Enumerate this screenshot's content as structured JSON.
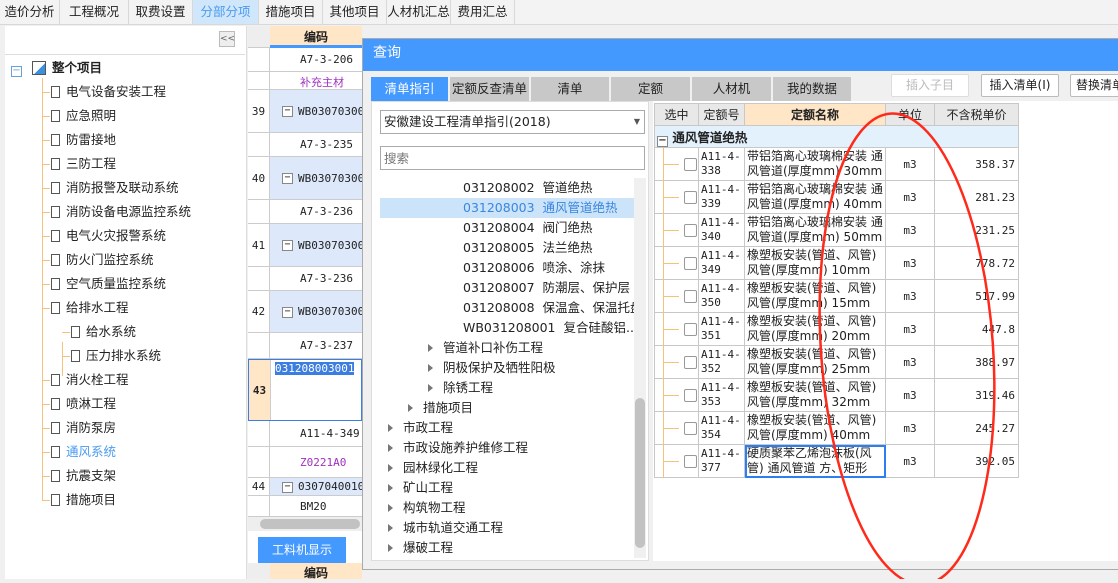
{
  "topnav": [
    "造价分析",
    "工程概况",
    "取费设置",
    "分部分项",
    "措施项目",
    "其他项目",
    "人材机汇总",
    "费用汇总"
  ],
  "left_tree": {
    "root": "整个项目",
    "items": [
      {
        "label": "电气设备安装工程",
        "level": 1
      },
      {
        "label": "应急照明",
        "level": 1
      },
      {
        "label": "防雷接地",
        "level": 1
      },
      {
        "label": "三防工程",
        "level": 1
      },
      {
        "label": "消防报警及联动系统",
        "level": 1
      },
      {
        "label": "消防设备电源监控系统",
        "level": 1
      },
      {
        "label": "电气火灾报警系统",
        "level": 1
      },
      {
        "label": "防火门监控系统",
        "level": 1
      },
      {
        "label": "空气质量监控系统",
        "level": 1
      },
      {
        "label": "给排水工程",
        "level": 1
      },
      {
        "label": "给水系统",
        "level": 2
      },
      {
        "label": "压力排水系统",
        "level": 2
      },
      {
        "label": "消火栓工程",
        "level": 1
      },
      {
        "label": "喷淋工程",
        "level": 1
      },
      {
        "label": "消防泵房",
        "level": 1
      },
      {
        "label": "通风系统",
        "level": 1,
        "active": true
      },
      {
        "label": "抗震支架",
        "level": 1
      },
      {
        "label": "措施项目",
        "level": 1
      }
    ]
  },
  "grid": {
    "header": "编码",
    "rows": [
      {
        "n": "",
        "code": "A7-3-206"
      },
      {
        "n": "",
        "code": "补充主材"
      },
      {
        "n": "39",
        "code": "WB03070300"
      },
      {
        "n": "",
        "code": "A7-3-235"
      },
      {
        "n": "40",
        "code": "WB03070300"
      },
      {
        "n": "",
        "code": "A7-3-236"
      },
      {
        "n": "41",
        "code": "WB03070300"
      },
      {
        "n": "",
        "code": "A7-3-236"
      },
      {
        "n": "42",
        "code": "WB03070300"
      },
      {
        "n": "",
        "code": "A7-3-237"
      },
      {
        "n": "43",
        "code": "031208003001"
      },
      {
        "n": "",
        "code": "A11-4-349"
      },
      {
        "n": "",
        "code": "Z0221A0"
      },
      {
        "n": "44",
        "code": "0307040010"
      },
      {
        "n": "",
        "code": "BM20"
      }
    ],
    "bottom_tab": "工料机显示",
    "bottom_header": "编码"
  },
  "dialog": {
    "title": "查询",
    "tabs": [
      "清单指引",
      "定额反查清单",
      "清单",
      "定额",
      "人材机",
      "我的数据"
    ],
    "buttons": [
      "插入子目",
      "插入清单(I)",
      "替换清单"
    ],
    "select": "安徽建设工程清单指引(2018)",
    "search_placeholder": "搜索",
    "codes": [
      {
        "code": "031208002",
        "name": "管道绝热"
      },
      {
        "code": "031208003",
        "name": "通风管道绝热",
        "selected": true
      },
      {
        "code": "031208004",
        "name": "阀门绝热"
      },
      {
        "code": "031208005",
        "name": "法兰绝热"
      },
      {
        "code": "031208006",
        "name": "喷涂、涂抹"
      },
      {
        "code": "031208007",
        "name": "防潮层、保护层"
      },
      {
        "code": "031208008",
        "name": "保温盒、保温托盘"
      },
      {
        "code": "WB031208001",
        "name": "复合硅酸铝..."
      }
    ],
    "folders": [
      {
        "label": "管道补口补伤工程",
        "level": 3
      },
      {
        "label": "阴极保护及牺牲阳极",
        "level": 3
      },
      {
        "label": "除锈工程",
        "level": 3
      },
      {
        "label": "措施项目",
        "level": 2
      },
      {
        "label": "市政工程",
        "level": 1
      },
      {
        "label": "市政设施养护维修工程",
        "level": 1
      },
      {
        "label": "园林绿化工程",
        "level": 1
      },
      {
        "label": "矿山工程",
        "level": 1
      },
      {
        "label": "构筑物工程",
        "level": 1
      },
      {
        "label": "城市轨道交通工程",
        "level": 1
      },
      {
        "label": "爆破工程",
        "level": 1
      }
    ],
    "table": {
      "headers": [
        "选中",
        "定额号",
        "定额名称",
        "单位",
        "不含税单价"
      ],
      "group": "通风管道绝热",
      "rows": [
        {
          "code": "A11-4-338",
          "name": "带铝箔离心玻璃棉安装 通风管道(厚度mm) 30mm",
          "unit": "m3",
          "price": "358.37"
        },
        {
          "code": "A11-4-339",
          "name": "带铝箔离心玻璃棉安装 通风管道(厚度mm) 40mm",
          "unit": "m3",
          "price": "281.23"
        },
        {
          "code": "A11-4-340",
          "name": "带铝箔离心玻璃棉安装 通风管道(厚度mm) 50mm",
          "unit": "m3",
          "price": "231.25"
        },
        {
          "code": "A11-4-349",
          "name": "橡塑板安装(管道、风管) 风管(厚度mm) 10mm",
          "unit": "m3",
          "price": "778.72"
        },
        {
          "code": "A11-4-350",
          "name": "橡塑板安装(管道、风管) 风管(厚度mm) 15mm",
          "unit": "m3",
          "price": "517.99"
        },
        {
          "code": "A11-4-351",
          "name": "橡塑板安装(管道、风管) 风管(厚度mm) 20mm",
          "unit": "m3",
          "price": "447.8"
        },
        {
          "code": "A11-4-352",
          "name": "橡塑板安装(管道、风管) 风管(厚度mm) 25mm",
          "unit": "m3",
          "price": "388.97"
        },
        {
          "code": "A11-4-353",
          "name": "橡塑板安装(管道、风管) 风管(厚度mm) 32mm",
          "unit": "m3",
          "price": "319.46"
        },
        {
          "code": "A11-4-354",
          "name": "橡塑板安装(管道、风管) 风管(厚度mm) 40mm",
          "unit": "m3",
          "price": "245.27"
        },
        {
          "code": "A11-4-377",
          "name": "硬质聚苯乙烯泡沫板(风管) 通风管道 方、矩形",
          "unit": "m3",
          "price": "392.05"
        }
      ]
    }
  },
  "colors": {
    "accent": "#4499ff",
    "annotation": "#ff2a1a",
    "tree_line": "#f5c27a"
  }
}
